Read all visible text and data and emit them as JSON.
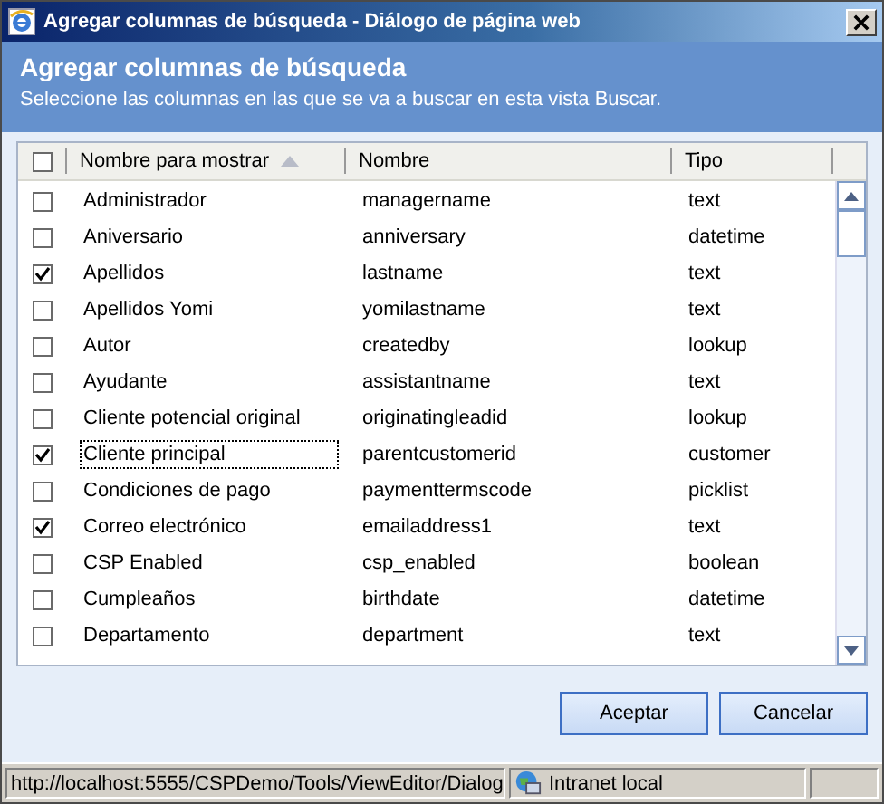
{
  "window": {
    "title": "Agregar columnas de búsqueda - Diálogo de página web"
  },
  "header": {
    "title": "Agregar columnas de búsqueda",
    "subtitle": "Seleccione las columnas en las que se va a buscar en esta vista Buscar."
  },
  "table": {
    "select_all_checked": false,
    "columns": [
      "Nombre para mostrar",
      "Nombre",
      "Tipo"
    ],
    "rows": [
      {
        "display": "Administrador",
        "name": "managername",
        "type": "text",
        "checked": false,
        "focused": false
      },
      {
        "display": "Aniversario",
        "name": "anniversary",
        "type": "datetime",
        "checked": false,
        "focused": false
      },
      {
        "display": "Apellidos",
        "name": "lastname",
        "type": "text",
        "checked": true,
        "focused": false
      },
      {
        "display": "Apellidos Yomi",
        "name": "yomilastname",
        "type": "text",
        "checked": false,
        "focused": false
      },
      {
        "display": "Autor",
        "name": "createdby",
        "type": "lookup",
        "checked": false,
        "focused": false
      },
      {
        "display": "Ayudante",
        "name": "assistantname",
        "type": "text",
        "checked": false,
        "focused": false
      },
      {
        "display": "Cliente potencial original",
        "name": "originatingleadid",
        "type": "lookup",
        "checked": false,
        "focused": false
      },
      {
        "display": "Cliente principal",
        "name": "parentcustomerid",
        "type": "customer",
        "checked": true,
        "focused": true
      },
      {
        "display": "Condiciones de pago",
        "name": "paymenttermscode",
        "type": "picklist",
        "checked": false,
        "focused": false
      },
      {
        "display": "Correo electrónico",
        "name": "emailaddress1",
        "type": "text",
        "checked": true,
        "focused": false
      },
      {
        "display": "CSP Enabled",
        "name": "csp_enabled",
        "type": "boolean",
        "checked": false,
        "focused": false
      },
      {
        "display": "Cumpleaños",
        "name": "birthdate",
        "type": "datetime",
        "checked": false,
        "focused": false
      },
      {
        "display": "Departamento",
        "name": "department",
        "type": "text",
        "checked": false,
        "focused": false
      }
    ]
  },
  "buttons": [
    "Aceptar",
    "Cancelar"
  ],
  "status_bar": {
    "url": "http://localhost:5555/CSPDemo/Tools/ViewEditor/Dialog",
    "zone": "Intranet local"
  }
}
